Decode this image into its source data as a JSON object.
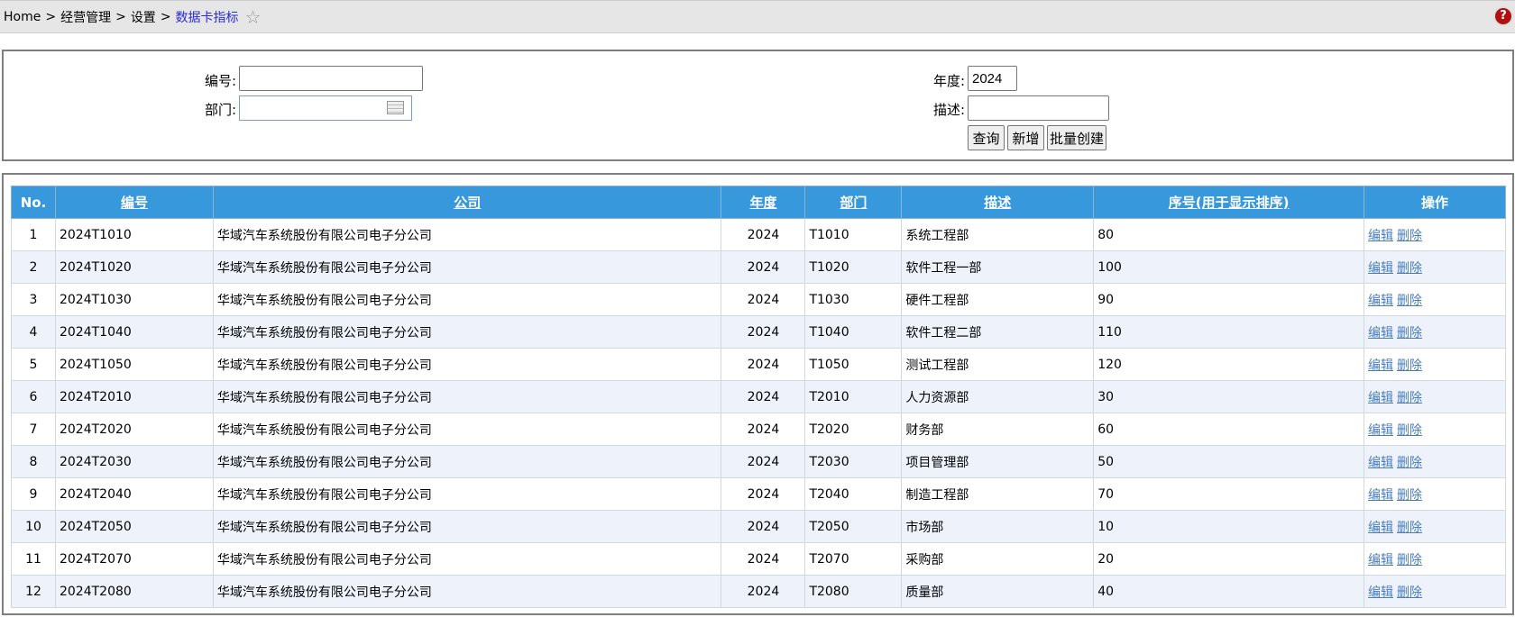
{
  "breadcrumb": {
    "items": [
      "Home",
      "经营管理",
      "设置"
    ],
    "current": "数据卡指标",
    "separator": ">"
  },
  "icons": {
    "star": "star-outline-icon",
    "help": "help-icon",
    "calendar": "calendar-icon"
  },
  "colors": {
    "header_bg": "#3799db",
    "link": "#4a7ebb",
    "current_crumb": "#2a2ae0"
  },
  "form": {
    "code_label": "编号:",
    "code_value": "",
    "dept_label": "部门:",
    "dept_value": "",
    "year_label": "年度:",
    "year_value": "2024",
    "desc_label": "描述:",
    "desc_value": "",
    "buttons": {
      "query": "查询",
      "add": "新增",
      "batch": "批量创建"
    }
  },
  "table": {
    "headers": [
      "No.",
      "编号",
      "公司",
      "年度",
      "部门",
      "描述",
      "序号(用于显示排序)",
      "操作"
    ],
    "actions": {
      "edit": "编辑",
      "delete": "删除"
    },
    "rows": [
      [
        "1",
        "2024T1010",
        "华域汽车系统股份有限公司电子分公司",
        "2024",
        "T1010",
        "系统工程部",
        "80"
      ],
      [
        "2",
        "2024T1020",
        "华域汽车系统股份有限公司电子分公司",
        "2024",
        "T1020",
        "软件工程一部",
        "100"
      ],
      [
        "3",
        "2024T1030",
        "华域汽车系统股份有限公司电子分公司",
        "2024",
        "T1030",
        "硬件工程部",
        "90"
      ],
      [
        "4",
        "2024T1040",
        "华域汽车系统股份有限公司电子分公司",
        "2024",
        "T1040",
        "软件工程二部",
        "110"
      ],
      [
        "5",
        "2024T1050",
        "华域汽车系统股份有限公司电子分公司",
        "2024",
        "T1050",
        "测试工程部",
        "120"
      ],
      [
        "6",
        "2024T2010",
        "华域汽车系统股份有限公司电子分公司",
        "2024",
        "T2010",
        "人力资源部",
        "30"
      ],
      [
        "7",
        "2024T2020",
        "华域汽车系统股份有限公司电子分公司",
        "2024",
        "T2020",
        "财务部",
        "60"
      ],
      [
        "8",
        "2024T2030",
        "华域汽车系统股份有限公司电子分公司",
        "2024",
        "T2030",
        "项目管理部",
        "50"
      ],
      [
        "9",
        "2024T2040",
        "华域汽车系统股份有限公司电子分公司",
        "2024",
        "T2040",
        "制造工程部",
        "70"
      ],
      [
        "10",
        "2024T2050",
        "华域汽车系统股份有限公司电子分公司",
        "2024",
        "T2050",
        "市场部",
        "10"
      ],
      [
        "11",
        "2024T2070",
        "华域汽车系统股份有限公司电子分公司",
        "2024",
        "T2070",
        "采购部",
        "20"
      ],
      [
        "12",
        "2024T2080",
        "华域汽车系统股份有限公司电子分公司",
        "2024",
        "T2080",
        "质量部",
        "40"
      ]
    ]
  }
}
